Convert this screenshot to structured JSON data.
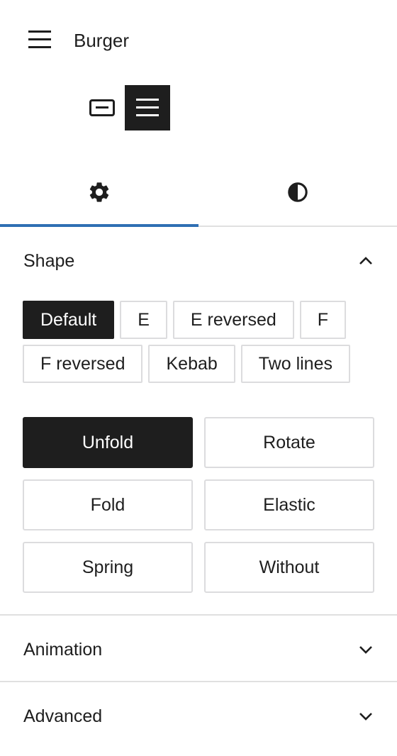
{
  "block": {
    "title": "Burger",
    "icon": "hamburger-icon"
  },
  "variations": [
    {
      "name": "pill-menu",
      "icon": "pill-menu-icon",
      "active": false
    },
    {
      "name": "burger",
      "icon": "hamburger-icon",
      "active": true
    }
  ],
  "tabs": [
    {
      "name": "settings",
      "icon": "gear-icon",
      "active": true
    },
    {
      "name": "styles",
      "icon": "contrast-icon",
      "active": false
    }
  ],
  "shape_panel": {
    "title": "Shape",
    "expanded": true,
    "shapes": [
      "Default",
      "E",
      "E reversed",
      "F",
      "F reversed",
      "Kebab",
      "Two lines"
    ],
    "selected_shape": "Default",
    "styles": [
      "Unfold",
      "Rotate",
      "Fold",
      "Elastic",
      "Spring",
      "Without"
    ],
    "selected_style": "Unfold"
  },
  "animation_panel": {
    "title": "Animation",
    "expanded": false
  },
  "advanced_panel": {
    "title": "Advanced",
    "expanded": false
  },
  "colors": {
    "text": "#1e1e1e",
    "active_bg": "#1e1e1e",
    "tab_indicator": "#2f6fb3",
    "border": "#dcdcde",
    "divider": "#e0e0e0"
  }
}
